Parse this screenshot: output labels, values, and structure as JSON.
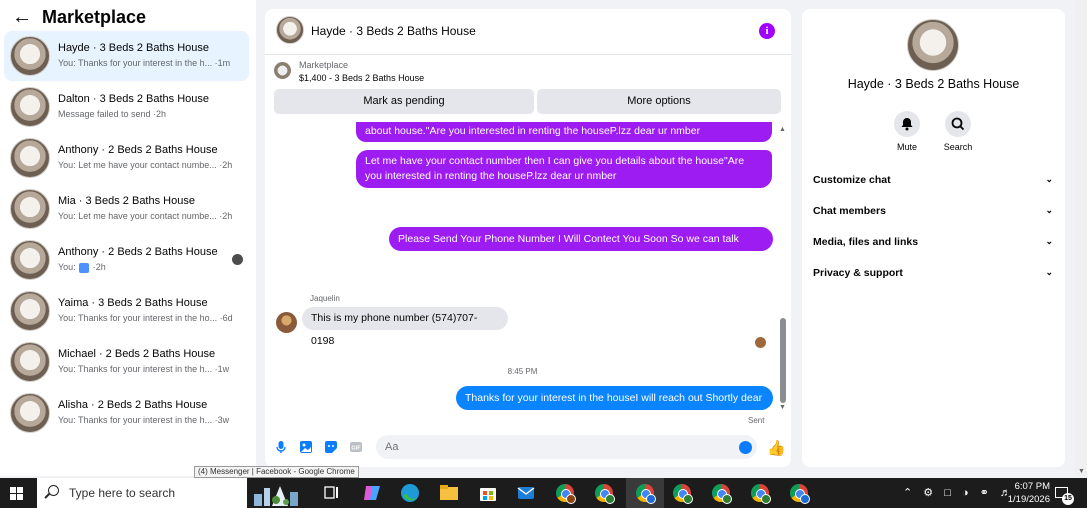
{
  "left_panel": {
    "title": "Marketplace",
    "conversations": [
      {
        "name": "Hayde · 3 Beds 2 Baths House",
        "preview": "You: Thanks for your interest in the h... ·1m",
        "active": true
      },
      {
        "name": "Dalton · 3 Beds 2 Baths House",
        "preview": "Message failed to send ·2h"
      },
      {
        "name": "Anthony · 2 Beds 2 Baths House",
        "preview": "You: Let me have your contact numbe... ·2h"
      },
      {
        "name": "Mia · 3 Beds 2 Baths House",
        "preview": "You: Let me have your contact numbe... ·2h"
      },
      {
        "name": "Anthony · 2 Beds 2 Baths House",
        "preview_prefix": "You:",
        "preview_suffix": "·2h",
        "has_seen_avatar": true
      },
      {
        "name": "Yaima · 3 Beds 2 Baths House",
        "preview": "You: Thanks for your interest in the ho... ·6d"
      },
      {
        "name": "Michael · 2 Beds 2 Baths House",
        "preview": "You: Thanks for your interest in the h... ·1w"
      },
      {
        "name": "Alisha · 2 Beds 2 Baths House",
        "preview": "You: Thanks for your interest in the h... ·3w"
      }
    ]
  },
  "chat": {
    "title": "Hayde · 3 Beds 2 Baths House",
    "info_icon": "i",
    "marketplace_label": "Marketplace",
    "listing": "$1,400 - 3 Beds 2 Baths House",
    "mark_pending_label": "Mark as pending",
    "more_options_label": "More options",
    "messages": {
      "m1": "about house.\"Are you interested in renting the houseP.lzz dear ur nmber",
      "m2_line1": "Let me have your contact number then I can give you details about the house\"Are",
      "m2_line2": "you interested in renting the houseP.lzz dear ur nmber",
      "m3": "Please Send Your Phone Number I Will Contect You Soon So we can talk more.",
      "sender_name": "Jaquelin",
      "m4": "This is my phone number (574)707-0198",
      "time": "8:45 PM",
      "m5": "Thanks for your interest in the houseI will reach out Shortly dear",
      "status": "Sent"
    },
    "composer_placeholder": "Aa"
  },
  "right_panel": {
    "name": "Hayde · 3 Beds 2 Baths House",
    "mute_label": "Mute",
    "search_label": "Search",
    "sections": [
      "Customize chat",
      "Chat members",
      "Media, files and links",
      "Privacy & support"
    ]
  },
  "tooltip": "(4) Messenger | Facebook - Google Chrome",
  "taskbar": {
    "search_placeholder": "Type here to search",
    "time": "6:07 PM",
    "date": "1/19/2026",
    "notifications": "15"
  },
  "colors": {
    "accent_purple": "#9d1cf2",
    "accent_blue": "#0a84ff",
    "active_row": "#e7f3ff"
  }
}
